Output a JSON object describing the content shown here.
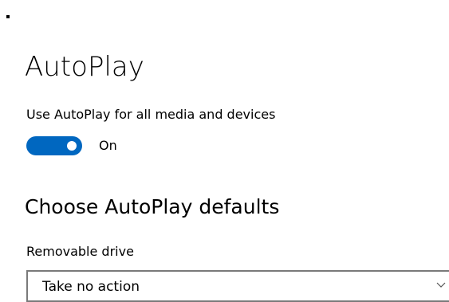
{
  "page": {
    "title": "AutoPlay"
  },
  "autoplay_setting": {
    "label": "Use AutoPlay for all media and devices",
    "state": "On",
    "enabled": true
  },
  "defaults_section": {
    "title": "Choose AutoPlay defaults",
    "removable_drive": {
      "label": "Removable drive",
      "selected": "Take no action"
    }
  },
  "colors": {
    "accent": "#0067c0",
    "toggle_knob": "#ffffff",
    "dropdown_border": "#7a7a7a",
    "text": "#000000",
    "background": "#ffffff"
  },
  "icons": {
    "dropdown_chevron": "chevron-down-icon"
  }
}
